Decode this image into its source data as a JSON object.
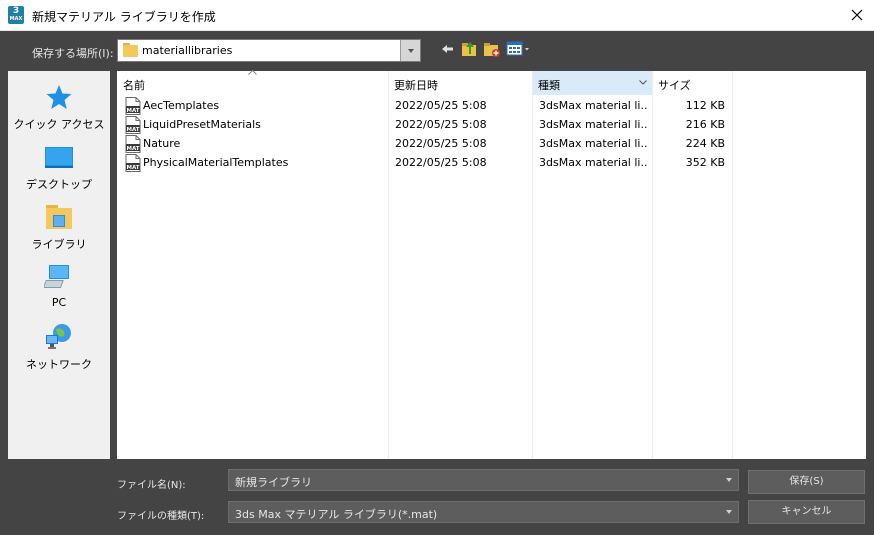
{
  "window": {
    "title": "新規マテリアル ライブラリを作成",
    "app_icon": "3ds-max-app-icon",
    "app_icon_text": "3",
    "app_icon_sub": "MAX"
  },
  "toolbar": {
    "save_in_label": "保存する場所(I):",
    "current_folder": "materiallibraries",
    "buttons": [
      "back-arrow-icon",
      "up-folder-icon",
      "new-folder-icon",
      "view-menu-icon"
    ]
  },
  "places": [
    {
      "label": "クイック アクセス",
      "icon": "quick-access-star-icon"
    },
    {
      "label": "デスクトップ",
      "icon": "desktop-icon"
    },
    {
      "label": "ライブラリ",
      "icon": "libraries-icon"
    },
    {
      "label": "PC",
      "icon": "pc-icon"
    },
    {
      "label": "ネットワーク",
      "icon": "network-icon"
    }
  ],
  "columns": [
    {
      "label": "名前"
    },
    {
      "label": "更新日時"
    },
    {
      "label": "種類"
    },
    {
      "label": "サイズ"
    }
  ],
  "files": [
    {
      "name": "AecTemplates",
      "modified": "2022/05/25 5:08",
      "type": "3dsMax material li...",
      "size": "112 KB"
    },
    {
      "name": "LiquidPresetMaterials",
      "modified": "2022/05/25 5:08",
      "type": "3dsMax material li...",
      "size": "216 KB"
    },
    {
      "name": "Nature",
      "modified": "2022/05/25 5:08",
      "type": "3dsMax material li...",
      "size": "224 KB"
    },
    {
      "name": "PhysicalMaterialTemplates",
      "modified": "2022/05/25 5:08",
      "type": "3dsMax material li...",
      "size": "352 KB"
    }
  ],
  "file_icon_text": "MAT",
  "footer": {
    "filename_label": "ファイル名(N):",
    "filename_value": "新規ライブラリ",
    "filetype_label": "ファイルの種類(T):",
    "filetype_value": "3ds Max マテリアル ライブラリ(*.mat)",
    "save_button": "保存(S)",
    "cancel_button": "キャンセル"
  },
  "colors": {
    "dialog_bg": "#444444",
    "selected_column": "#d9ebf9",
    "folder_yellow": "#f3c85c",
    "icon_blue": "#1e90e6"
  }
}
